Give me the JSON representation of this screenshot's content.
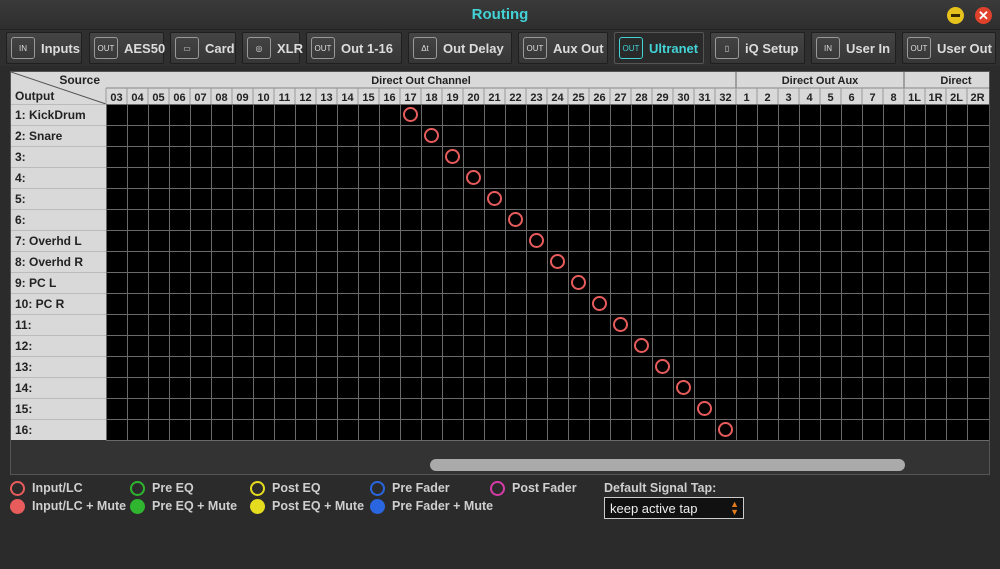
{
  "window": {
    "title": "Routing"
  },
  "tabs": [
    {
      "label": "Inputs",
      "icon": "in-icon",
      "glyph": "IN",
      "active": false
    },
    {
      "label": "AES50",
      "icon": "out-icon",
      "glyph": "OUT",
      "active": false
    },
    {
      "label": "Card",
      "icon": "card-icon",
      "glyph": "▭",
      "active": false
    },
    {
      "label": "XLR",
      "icon": "xlr-icon",
      "glyph": "◎",
      "active": false
    },
    {
      "label": "Out 1-16",
      "icon": "out-icon",
      "glyph": "OUT",
      "active": false
    },
    {
      "label": "Out Delay",
      "icon": "delay-icon",
      "glyph": "Δt",
      "active": false
    },
    {
      "label": "Aux Out",
      "icon": "out-icon",
      "glyph": "OUT",
      "active": false
    },
    {
      "label": "Ultranet",
      "icon": "out-icon",
      "glyph": "OUT",
      "active": true
    },
    {
      "label": "iQ Setup",
      "icon": "speaker-icon",
      "glyph": "▯",
      "active": false
    },
    {
      "label": "User In",
      "icon": "in-icon",
      "glyph": "IN",
      "active": false
    },
    {
      "label": "User Out",
      "icon": "out-icon",
      "glyph": "OUT",
      "active": false
    }
  ],
  "grid": {
    "source_label": "Source",
    "output_label": "Output",
    "groups": [
      {
        "label": "Direct Out Channel",
        "columns": [
          "03",
          "04",
          "05",
          "06",
          "07",
          "08",
          "09",
          "10",
          "11",
          "12",
          "13",
          "14",
          "15",
          "16",
          "17",
          "18",
          "19",
          "20",
          "21",
          "22",
          "23",
          "24",
          "25",
          "26",
          "27",
          "28",
          "29",
          "30",
          "31",
          "32"
        ]
      },
      {
        "label": "Direct Out Aux",
        "columns": [
          "1",
          "2",
          "3",
          "4",
          "5",
          "6",
          "7",
          "8"
        ]
      },
      {
        "label": "Direct",
        "columns": [
          "1L",
          "1R",
          "2L",
          "2R"
        ]
      }
    ],
    "rows": [
      {
        "label": "1: KickDrum",
        "source": "17"
      },
      {
        "label": "2: Snare",
        "source": "18"
      },
      {
        "label": "3:",
        "source": "19"
      },
      {
        "label": "4:",
        "source": "20"
      },
      {
        "label": "5:",
        "source": "21"
      },
      {
        "label": "6:",
        "source": "22"
      },
      {
        "label": "7: Overhd L",
        "source": "23"
      },
      {
        "label": "8: Overhd R",
        "source": "24"
      },
      {
        "label": "9: PC L",
        "source": "25"
      },
      {
        "label": "10: PC R",
        "source": "26"
      },
      {
        "label": "11:",
        "source": "27"
      },
      {
        "label": "12:",
        "source": "28"
      },
      {
        "label": "13:",
        "source": "29"
      },
      {
        "label": "14:",
        "source": "30"
      },
      {
        "label": "15:",
        "source": "31"
      },
      {
        "label": "16:",
        "source": "32"
      }
    ],
    "marker_color": "#e85c5c",
    "horizontal_scroll_fraction": 0.52
  },
  "legend": [
    {
      "label": "Input/LC",
      "color": "#e85c5c",
      "style": "ring"
    },
    {
      "label": "Pre EQ",
      "color": "#2fb52f",
      "style": "ring"
    },
    {
      "label": "Post EQ",
      "color": "#e6dc1f",
      "style": "ring"
    },
    {
      "label": "Pre Fader",
      "color": "#2966e0",
      "style": "ring"
    },
    {
      "label": "Post Fader",
      "color": "#d63ca8",
      "style": "ring"
    },
    {
      "label": "Input/LC + Mute",
      "color": "#e85c5c",
      "style": "filled"
    },
    {
      "label": "Pre EQ + Mute",
      "color": "#2fb52f",
      "style": "filled"
    },
    {
      "label": "Post EQ + Mute",
      "color": "#e6dc1f",
      "style": "filled"
    },
    {
      "label": "Pre Fader + Mute",
      "color": "#2966e0",
      "style": "filled"
    }
  ],
  "signal_tap": {
    "label": "Default Signal Tap:",
    "value": "keep active tap"
  }
}
